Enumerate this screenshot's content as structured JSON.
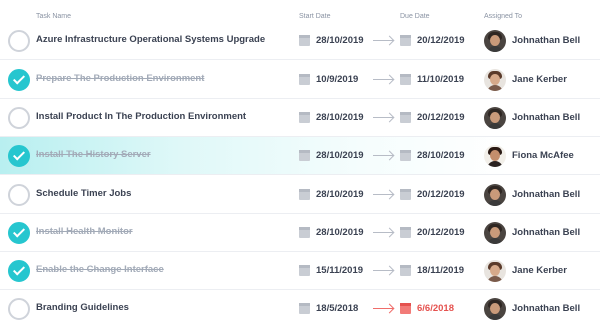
{
  "columns": {
    "task_name": "Task Name",
    "start_date": "Start Date",
    "due_date": "Due Date",
    "assigned_to": "Assigned To"
  },
  "colors": {
    "accent": "#26c6cf",
    "overdue": "#e5524f"
  },
  "tasks": [
    {
      "name": "Azure Infrastructure Operational Systems Upgrade",
      "done": false,
      "start": "28/10/2019",
      "due": "20/12/2019",
      "assignee": "Johnathan Bell",
      "overdue": false,
      "highlighted": false
    },
    {
      "name": "Prepare The Production Environment",
      "done": true,
      "start": "10/9/2019",
      "due": "11/10/2019",
      "assignee": "Jane Kerber",
      "overdue": false,
      "highlighted": false
    },
    {
      "name": "Install Product In The Production Environment",
      "done": false,
      "start": "28/10/2019",
      "due": "20/12/2019",
      "assignee": "Johnathan Bell",
      "overdue": false,
      "highlighted": false
    },
    {
      "name": "Install The History Server",
      "done": true,
      "start": "28/10/2019",
      "due": "28/10/2019",
      "assignee": "Fiona McAfee",
      "overdue": false,
      "highlighted": true
    },
    {
      "name": "Schedule Timer Jobs",
      "done": false,
      "start": "28/10/2019",
      "due": "20/12/2019",
      "assignee": "Johnathan Bell",
      "overdue": false,
      "highlighted": false
    },
    {
      "name": "Install Health Monitor",
      "done": true,
      "start": "28/10/2019",
      "due": "20/12/2019",
      "assignee": "Johnathan Bell",
      "overdue": false,
      "highlighted": false
    },
    {
      "name": "Enable the Change Interface",
      "done": true,
      "start": "15/11/2019",
      "due": "18/11/2019",
      "assignee": "Jane Kerber",
      "overdue": false,
      "highlighted": false
    },
    {
      "name": "Branding Guidelines",
      "done": false,
      "start": "18/5/2018",
      "due": "6/6/2018",
      "assignee": "Johnathan Bell",
      "overdue": true,
      "highlighted": false
    }
  ]
}
